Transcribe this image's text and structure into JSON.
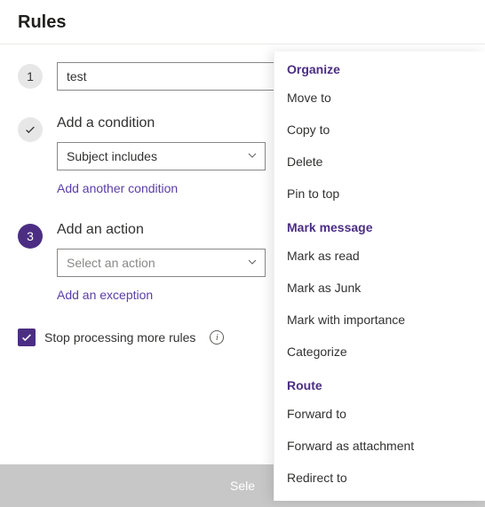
{
  "header": {
    "title": "Rules"
  },
  "steps": {
    "s1": {
      "badge": "1",
      "nameValue": "test"
    },
    "s2": {
      "title": "Add a condition",
      "selectValue": "Subject includes",
      "addLink": "Add another condition"
    },
    "s3": {
      "badge": "3",
      "title": "Add an action",
      "selectPlaceholder": "Select an action",
      "addLink": "Add an exception"
    }
  },
  "stopRule": {
    "label": "Stop processing more rules"
  },
  "footer": {
    "partial": "Sele"
  },
  "menu": {
    "g1": {
      "header": "Organize",
      "i1": "Move to",
      "i2": "Copy to",
      "i3": "Delete",
      "i4": "Pin to top"
    },
    "g2": {
      "header": "Mark message",
      "i1": "Mark as read",
      "i2": "Mark as Junk",
      "i3": "Mark with importance",
      "i4": "Categorize"
    },
    "g3": {
      "header": "Route",
      "i1": "Forward to",
      "i2": "Forward as attachment",
      "i3": "Redirect to"
    }
  }
}
